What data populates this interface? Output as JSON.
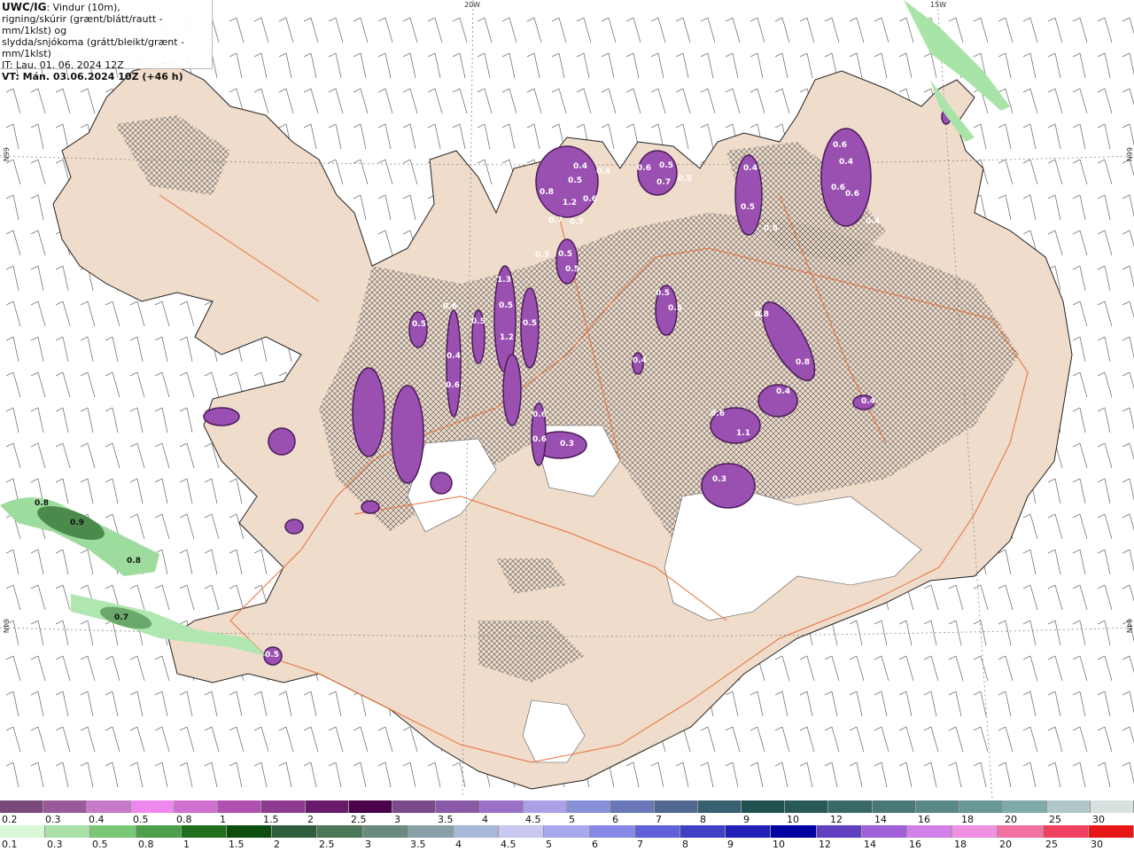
{
  "header": {
    "title_bold": "UWC/IG",
    "title_rest": ": Vindur (10m),",
    "line2": "rigning/skúrir (grænt/blátt/rautt - mm/1klst) og",
    "line3": "slydda/snjókoma (grátt/bleikt/grænt - mm/1klst)",
    "line4": "IT: Lau. 01. 06. 2024 12Z",
    "line5": "VT: Mán. 03.06.2024 10Z (+46 h)"
  },
  "coords": {
    "lon_20w": "20W",
    "lon_15w": "15W",
    "lat_66n_left": "66N",
    "lat_66n_right": "66N",
    "lat_64n_left": "64N",
    "lat_64n_right": "64N"
  },
  "purple_labels": [
    "0.4",
    "0.5",
    "0.4",
    "0.8",
    "1.2",
    "0.6",
    "0.7",
    "0.7",
    "0.5",
    "0.6",
    "0.7",
    "0.5",
    "0.6",
    "0.4",
    "0.4",
    "0.6",
    "0.6",
    "0.5",
    "0.4",
    "0.5",
    "0.3",
    "0.5",
    "0.5",
    "1.3",
    "0.6",
    "0.5",
    "0.5",
    "0.5",
    "0.5",
    "0.4",
    "0.6",
    "1.2",
    "0.6",
    "0.6",
    "0.3",
    "0.5",
    "0.5",
    "0.4",
    "0.8",
    "0.8",
    "0.4",
    "0.6",
    "1.1",
    "0.3",
    "0.4",
    "0.5"
  ],
  "green_labels": [
    "0.8",
    "0.9",
    "0.8",
    "0.7"
  ],
  "legend_top": {
    "labels": [
      "0.2",
      "0.3",
      "0.4",
      "0.5",
      "0.8",
      "1",
      "1.5",
      "2",
      "2.5",
      "3",
      "3.5",
      "4",
      "4.5",
      "5",
      "6",
      "7",
      "8",
      "9",
      "10",
      "12",
      "14",
      "16",
      "18",
      "20",
      "25",
      "30"
    ],
    "colors": [
      "#7a4a7a",
      "#9a5a9a",
      "#c77ac7",
      "#ee88ee",
      "#d070d0",
      "#b050b0",
      "#8e3a8e",
      "#6a1a6a",
      "#4a004a",
      "#7a4a8a",
      "#8a5aa8",
      "#9a70c8",
      "#aaa0e8",
      "#8890d8",
      "#6878b8",
      "#506890",
      "#386070",
      "#205050",
      "#285858",
      "#386868",
      "#4a7878",
      "#5a8888",
      "#6a9898",
      "#80aaaa",
      "#b0c8c8",
      "#d8e0e0"
    ]
  },
  "legend_bottom": {
    "labels": [
      "0.1",
      "0.3",
      "0.5",
      "0.8",
      "1",
      "1.5",
      "2",
      "2.5",
      "3",
      "3.5",
      "4",
      "4.5",
      "5",
      "6",
      "7",
      "8",
      "9",
      "10",
      "12",
      "14",
      "16",
      "18",
      "20",
      "25",
      "30"
    ],
    "colors": [
      "#d8f8d8",
      "#a8e0a8",
      "#78c878",
      "#4ca04c",
      "#1f6f1f",
      "#0d4d0d",
      "#2e5e3e",
      "#4a7858",
      "#6a8a80",
      "#8aa0a8",
      "#a8b8d8",
      "#c8c8f0",
      "#a8a8f0",
      "#8888e8",
      "#6060d8",
      "#4040c8",
      "#2020b8",
      "#0000a0",
      "#6040c0",
      "#a060d8",
      "#d080e8",
      "#f090e0",
      "#f070a0",
      "#f04060",
      "#e81818"
    ]
  }
}
